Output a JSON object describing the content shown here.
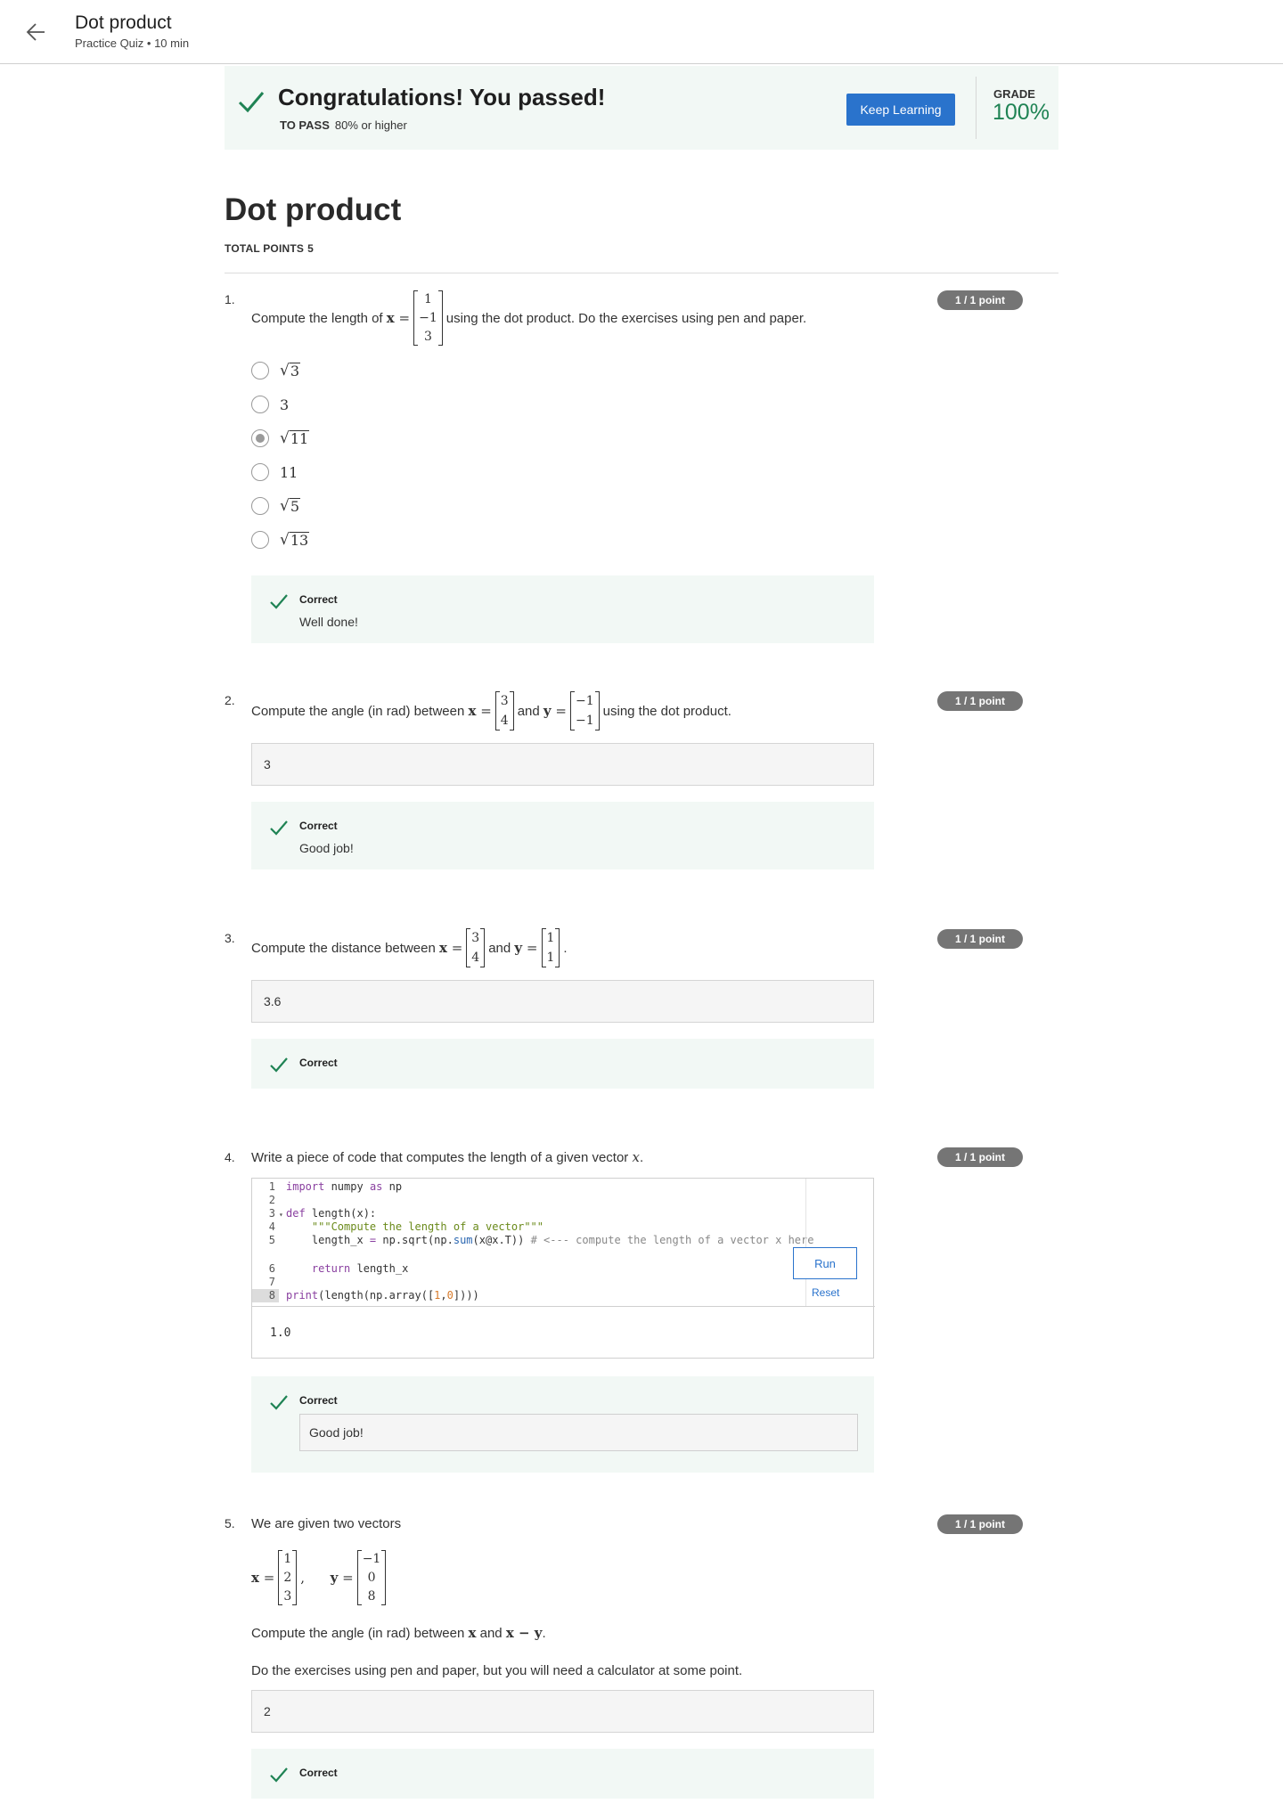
{
  "header": {
    "title": "Dot product",
    "subtitle": "Practice Quiz • 10 min"
  },
  "banner": {
    "title": "Congratulations! You passed!",
    "to_pass_label": "TO PASS",
    "to_pass_value": "80% or higher",
    "keep_learning": "Keep Learning",
    "grade_label": "GRADE",
    "grade_value": "100%"
  },
  "quiz": {
    "title": "Dot product",
    "total_points_label": "TOTAL POINTS",
    "total_points_value": "5"
  },
  "questions": [
    {
      "number": "1.",
      "points": "1 / 1 point",
      "text_before": "Compute the length of",
      "var": "x",
      "eq": "=",
      "vector": [
        "1",
        "−1",
        "3"
      ],
      "text_after": "using the dot product. Do the exercises using pen and paper.",
      "options": [
        {
          "sqrt": true,
          "value": "3",
          "selected": false
        },
        {
          "sqrt": false,
          "value": "3",
          "selected": false
        },
        {
          "sqrt": true,
          "value": "11",
          "selected": true
        },
        {
          "sqrt": false,
          "value": "11",
          "selected": false
        },
        {
          "sqrt": true,
          "value": "5",
          "selected": false
        },
        {
          "sqrt": true,
          "value": "13",
          "selected": false
        }
      ],
      "feedback_title": "Correct",
      "feedback_msg": "Well done!"
    },
    {
      "number": "2.",
      "points": "1 / 1 point",
      "text_before": "Compute the angle (in rad) between",
      "var1": "x",
      "eq": "=",
      "vec1": [
        "3",
        "4"
      ],
      "and": "and",
      "var2": "y",
      "vec2": [
        "−1",
        "−1"
      ],
      "text_after": "using the dot product.",
      "answer": "3",
      "feedback_title": "Correct",
      "feedback_msg": "Good job!"
    },
    {
      "number": "3.",
      "points": "1 / 1 point",
      "text_before": "Compute the distance between",
      "var1": "x",
      "eq": "=",
      "vec1": [
        "3",
        "4"
      ],
      "and": "and",
      "var2": "y",
      "vec2": [
        "1",
        "1"
      ],
      "text_after": ".",
      "answer": "3.6",
      "feedback_title": "Correct"
    },
    {
      "number": "4.",
      "points": "1 / 1 point",
      "text_before": "Write a piece of code that computes the length of a given vector",
      "var": "x",
      "text_after": ".",
      "run": "Run",
      "reset": "Reset",
      "output": "1.0",
      "feedback_title": "Correct",
      "feedback_msg": "Good job!"
    },
    {
      "number": "5.",
      "points": "1 / 1 point",
      "text_intro": "We are given two vectors",
      "var1": "x",
      "eq": "=",
      "vec1": [
        "1",
        "2",
        "3"
      ],
      "comma": ",",
      "var2": "y",
      "vec2": [
        "−1",
        "0",
        "8"
      ],
      "line2_before": "Compute the angle (in rad) between",
      "line2_var1": "x",
      "line2_and": "and",
      "line2_expr": "x − y",
      "line2_after": ".",
      "line3": "Do the exercises using pen and paper, but you will need a calculator at some point.",
      "answer": "2",
      "feedback_title": "Correct"
    }
  ],
  "code": {
    "lines": [
      {
        "n": "1",
        "fold": false,
        "parts": [
          [
            "kw",
            "import"
          ],
          [
            "plain",
            " numpy "
          ],
          [
            "kw",
            "as"
          ],
          [
            "plain",
            " np"
          ]
        ]
      },
      {
        "n": "2",
        "fold": false,
        "parts": []
      },
      {
        "n": "3",
        "fold": true,
        "parts": [
          [
            "kw",
            "def"
          ],
          [
            "plain",
            " length(x):"
          ]
        ]
      },
      {
        "n": "4",
        "fold": false,
        "parts": [
          [
            "plain",
            "    "
          ],
          [
            "str",
            "\"\"\"Compute the length of a vector\"\"\""
          ]
        ]
      },
      {
        "n": "5",
        "fold": false,
        "parts": [
          [
            "plain",
            "    length_x "
          ],
          [
            "kw",
            "="
          ],
          [
            "plain",
            " np.sqrt(np."
          ],
          [
            "fn",
            "sum"
          ],
          [
            "plain",
            "(x@x.T)) "
          ],
          [
            "cmt",
            "# <--- compute the length of a vector x here"
          ]
        ]
      },
      {
        "n": "6",
        "fold": false,
        "parts": [
          [
            "plain",
            "    "
          ],
          [
            "kw",
            "return"
          ],
          [
            "plain",
            " length_x"
          ]
        ]
      },
      {
        "n": "7",
        "fold": false,
        "parts": []
      },
      {
        "n": "8",
        "fold": false,
        "parts": [
          [
            "kw",
            "print"
          ],
          [
            "plain",
            "(length(np.array(["
          ],
          [
            "num",
            "1"
          ],
          [
            "plain",
            ","
          ],
          [
            "num",
            "0"
          ],
          [
            "plain",
            "])))"
          ]
        ]
      }
    ]
  },
  "colors": {
    "accent": "#2a73cc",
    "success": "#1f8354",
    "feedback_bg": "#f2f8f5",
    "badge": "#757575"
  }
}
